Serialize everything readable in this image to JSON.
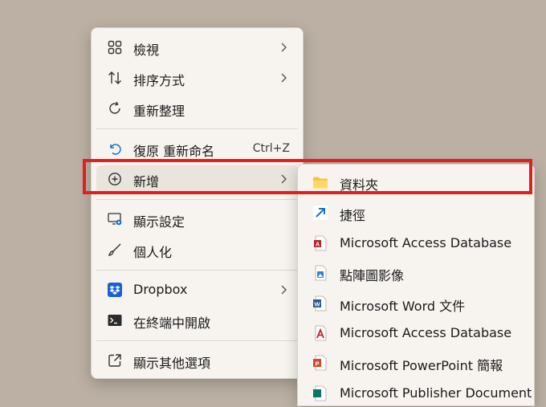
{
  "main_menu": {
    "items": [
      {
        "label": "檢視",
        "icon": "grid-icon",
        "has_submenu": true
      },
      {
        "label": "排序方式",
        "icon": "sort-icon",
        "has_submenu": true
      },
      {
        "label": "重新整理",
        "icon": "refresh-icon",
        "has_submenu": false
      },
      {
        "label": "復原 重新命名",
        "icon": "undo-icon",
        "shortcut": "Ctrl+Z"
      },
      {
        "label": "新增",
        "icon": "add-circle-icon",
        "has_submenu": true
      },
      {
        "label": "顯示設定",
        "icon": "display-settings-icon"
      },
      {
        "label": "個人化",
        "icon": "brush-icon"
      },
      {
        "label": "Dropbox",
        "icon": "dropbox-icon",
        "has_submenu": true
      },
      {
        "label": "在終端中開啟",
        "icon": "terminal-icon"
      },
      {
        "label": "顯示其他選項",
        "icon": "external-icon"
      }
    ]
  },
  "new_submenu": {
    "items": [
      {
        "label": "資料夾",
        "icon": "folder-icon"
      },
      {
        "label": "捷徑",
        "icon": "shortcut-icon"
      },
      {
        "label": "Microsoft Access Database",
        "icon": "access-icon"
      },
      {
        "label": "點陣圖影像",
        "icon": "bitmap-icon"
      },
      {
        "label": "Microsoft Word 文件",
        "icon": "word-icon"
      },
      {
        "label": "Microsoft Access Database",
        "icon": "access-icon"
      },
      {
        "label": "Microsoft PowerPoint 簡報",
        "icon": "powerpoint-icon"
      },
      {
        "label": "Microsoft Publisher Document",
        "icon": "publisher-icon"
      }
    ]
  },
  "colors": {
    "desktop": "#bbb0a3",
    "menu_bg": "#f7f4ef",
    "highlight": "#e0201f",
    "accent_blue": "#1a73c8"
  }
}
